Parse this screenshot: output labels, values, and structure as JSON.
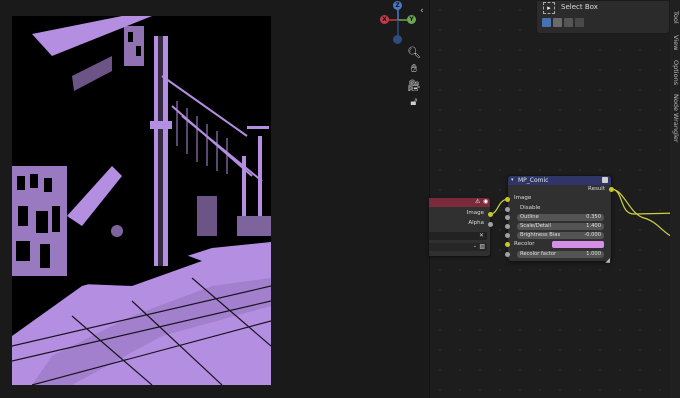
{
  "viewport": {
    "gizmo": {
      "x_label": "X",
      "y_label": "Y",
      "z_label": "Z"
    },
    "nav_icons": [
      "magnifier-icon",
      "hand-icon",
      "camera-icon",
      "lock-icon"
    ],
    "render_tint": "#b48ee0"
  },
  "toolbar": {
    "select_box_label": "Select Box"
  },
  "sidebar": {
    "tabs": [
      "Tool",
      "View",
      "Options",
      "Node Wrangler"
    ]
  },
  "node_left": {
    "output_image_label": "Image",
    "output_alpha_label": "Alpha",
    "header_color": "#7a2a3a"
  },
  "mp_comic": {
    "title": "MP_Comic",
    "header_color": "#2f3566",
    "result_label": "Result",
    "image_label": "Image",
    "disable_label": "Disable",
    "outline_label": "Outline",
    "outline_value": "0.350",
    "scale_label": "Scale/Detail",
    "scale_value": "1.400",
    "brightness_label": "Brightness Bias",
    "brightness_value": "-0.000",
    "recolor_label": "Recolor",
    "recolor_color": "#d58fe6",
    "recolor_factor_label": "Recolor factor",
    "recolor_factor_value": "1.000"
  },
  "colors": {
    "image_socket": "#c7c729",
    "value_socket": "#a1a1a1",
    "wire": "#d0d040"
  }
}
